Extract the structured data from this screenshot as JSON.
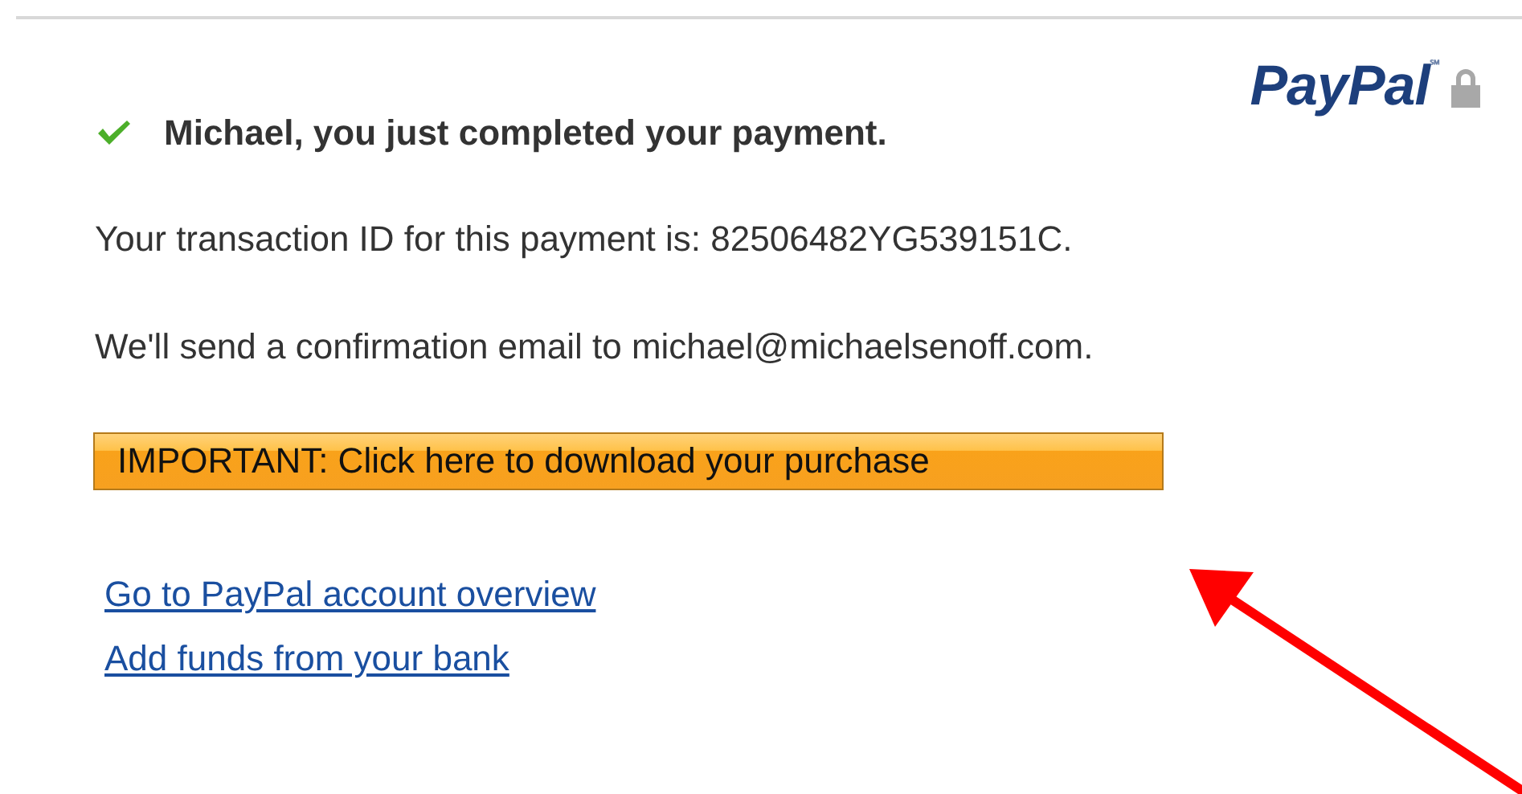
{
  "logo": {
    "text": "PayPal",
    "mark": "℠"
  },
  "heading": "Michael, you just completed your payment.",
  "paragraphs": [
    "Your transaction ID for this payment is: 82506482YG539151C.",
    "We'll send a confirmation email to michael@michaelsenoff.com."
  ],
  "download_button": "IMPORTANT: Click here to download your purchase",
  "links": [
    "Go to PayPal account overview",
    "Add funds from your bank"
  ]
}
